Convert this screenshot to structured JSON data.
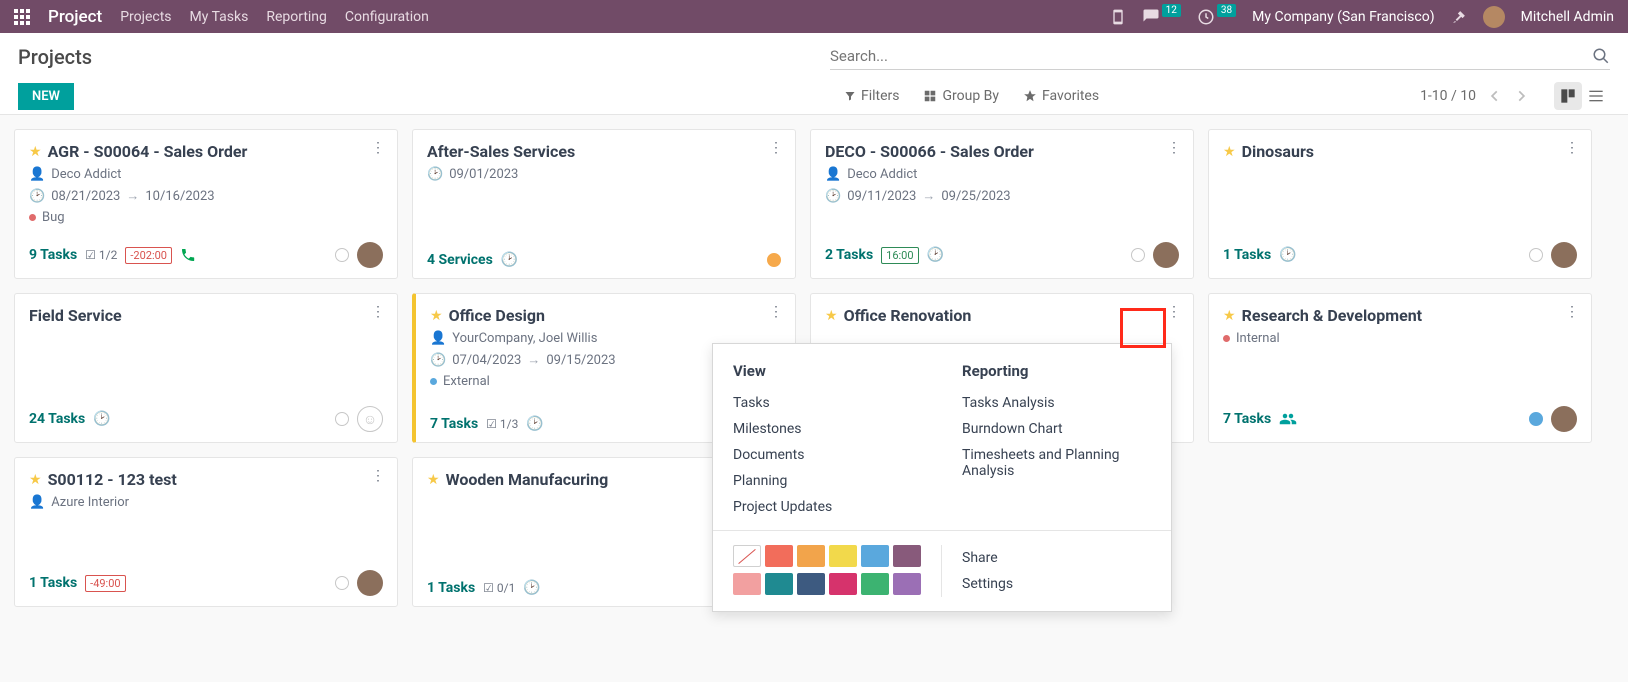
{
  "nav": {
    "brand": "Project",
    "items": [
      "Projects",
      "My Tasks",
      "Reporting",
      "Configuration"
    ],
    "msg_badge": "12",
    "clock_badge": "38",
    "company": "My Company (San Francisco)",
    "user": "Mitchell Admin"
  },
  "header": {
    "title": "Projects",
    "new_btn": "NEW",
    "search_placeholder": "Search...",
    "filters": "Filters",
    "groupby": "Group By",
    "favorites": "Favorites",
    "pager": "1-10 / 10"
  },
  "cards": {
    "c0": {
      "title": "AGR - S00064 - Sales Order",
      "partner": "Deco Addict",
      "d1": "08/21/2023",
      "d2": "10/16/2023",
      "tag": "Bug",
      "tasks": "9 Tasks",
      "ms": "1/2",
      "time": "-202:00"
    },
    "c1": {
      "title": "After-Sales Services",
      "date": "09/01/2023",
      "tasks": "4 Services"
    },
    "c2": {
      "title": "DECO - S00066 - Sales Order",
      "partner": "Deco Addict",
      "d1": "09/11/2023",
      "d2": "09/25/2023",
      "tasks": "2 Tasks",
      "time": "16:00"
    },
    "c3": {
      "title": "Dinosaurs",
      "tasks": "1 Tasks"
    },
    "c4": {
      "title": "Field Service",
      "tasks": "24 Tasks"
    },
    "c5": {
      "title": "Office Design",
      "partner": "YourCompany, Joel Willis",
      "d1": "07/04/2023",
      "d2": "09/15/2023",
      "tag": "External",
      "tasks": "7 Tasks",
      "ms": "1/3"
    },
    "c6": {
      "title": "Office Renovation"
    },
    "c7": {
      "title": "Research & Development",
      "tag": "Internal",
      "tasks": "7 Tasks"
    },
    "c8": {
      "title": "S00112 - 123 test",
      "partner": "Azure Interior",
      "tasks": "1 Tasks",
      "time": "-49:00"
    },
    "c9": {
      "title": "Wooden Manufacuring",
      "tasks": "1 Tasks",
      "ms": "0/1"
    }
  },
  "dropdown": {
    "view_title": "View",
    "reporting_title": "Reporting",
    "view_links": [
      "Tasks",
      "Milestones",
      "Documents",
      "Planning",
      "Project Updates"
    ],
    "rep_links": [
      "Tasks Analysis",
      "Burndown Chart",
      "Timesheets and Planning Analysis"
    ],
    "share": "Share",
    "settings": "Settings",
    "colors": [
      "#f26d5b",
      "#f2a44b",
      "#f2d94b",
      "#5aa8dd",
      "#885a7b",
      "#f2a0a0",
      "#1f8a91",
      "#3d5a80",
      "#d6336c",
      "#3cb371",
      "#9b6fb5"
    ]
  }
}
